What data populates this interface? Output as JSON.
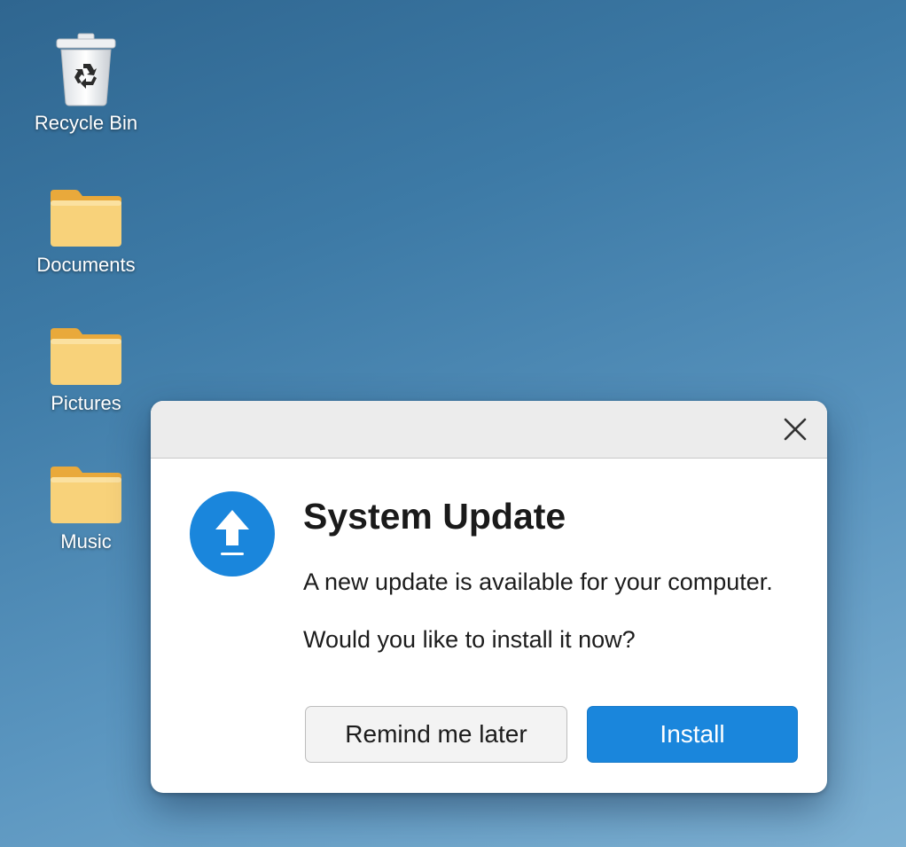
{
  "colors": {
    "desktop_background": "#3d7aa6",
    "primary_button": "#1a86dc",
    "update_icon": "#1a86dc",
    "folder": "#f8d27a"
  },
  "desktop": {
    "icons": [
      {
        "label": "Recycle Bin",
        "icon": "recycle-bin-icon"
      },
      {
        "label": "Documents",
        "icon": "folder-icon"
      },
      {
        "label": "Pictures",
        "icon": "folder-icon"
      },
      {
        "label": "Music",
        "icon": "folder-icon"
      }
    ]
  },
  "dialog": {
    "icon": "upload-arrow-icon",
    "close_icon": "close-icon",
    "title": "System Update",
    "message_line1": "A new update is available for your computer.",
    "message_line2": "Would you like to install it now?",
    "secondary_button_label": "Remind me later",
    "primary_button_label": "Install"
  }
}
